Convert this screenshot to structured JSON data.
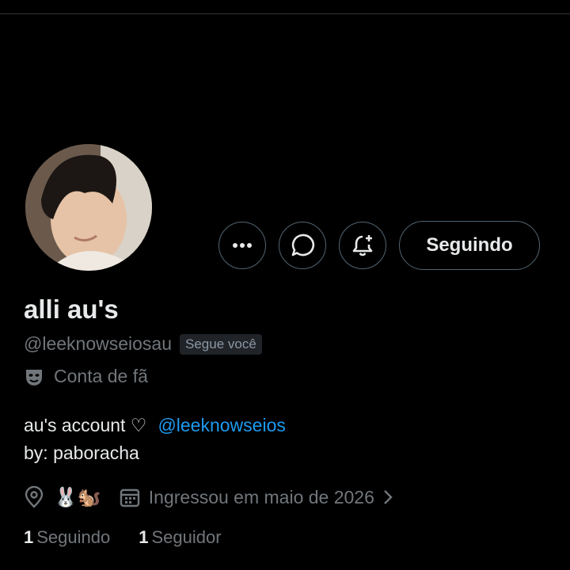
{
  "profile": {
    "display_name": "alli au's",
    "handle": "@leeknowseiosau",
    "follows_you_badge": "Segue você",
    "category": "Conta de fã",
    "bio_line1_text": "au's account ♡",
    "bio_line1_mention": "@leeknowseios",
    "bio_line2": "by: paboracha",
    "location_emoji": "🐰🐿️",
    "joined": "Ingressou em maio de 2026",
    "following_count": "1",
    "following_label": "Seguindo",
    "followers_count": "1",
    "followers_label": "Seguidor"
  },
  "actions": {
    "more_icon": "more-dots-icon",
    "message_icon": "message-bubble-icon",
    "notify_icon": "bell-plus-icon",
    "follow_label": "Seguindo"
  },
  "colors": {
    "background": "#000000",
    "text_primary": "#e7e9ea",
    "text_secondary": "#71767b",
    "link": "#1d9bf0",
    "border": "#536471"
  }
}
